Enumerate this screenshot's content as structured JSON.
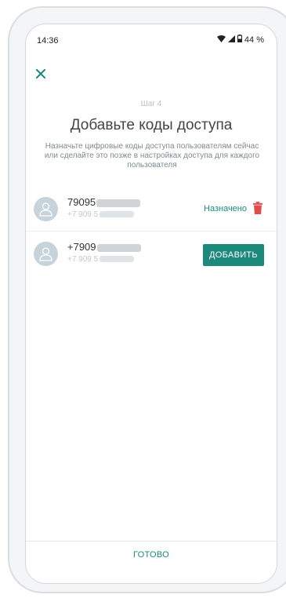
{
  "status_bar": {
    "time": "14:36",
    "battery": "44 %"
  },
  "header": {
    "step": "Шаг 4",
    "title": "Добавьте коды доступа",
    "subtitle": "Назначьте цифровые коды доступа пользователям сейчас или сделайте это позже в настройках доступа для каждого пользователя"
  },
  "users": [
    {
      "name": "79095",
      "phone": "+7 909 5",
      "status": "Назначено"
    },
    {
      "name": "+7909",
      "phone": "+7 909 5",
      "action": "ДОБАВИТЬ"
    }
  ],
  "footer": {
    "done_label": "ГОТОВО"
  },
  "colors": {
    "accent": "#1b8a7d",
    "delete": "#e04b4b",
    "avatar": "#c7d3da"
  },
  "icons": [
    "close-icon",
    "wifi-icon",
    "signal-icon",
    "battery-icon",
    "user-icon",
    "trash-icon"
  ]
}
